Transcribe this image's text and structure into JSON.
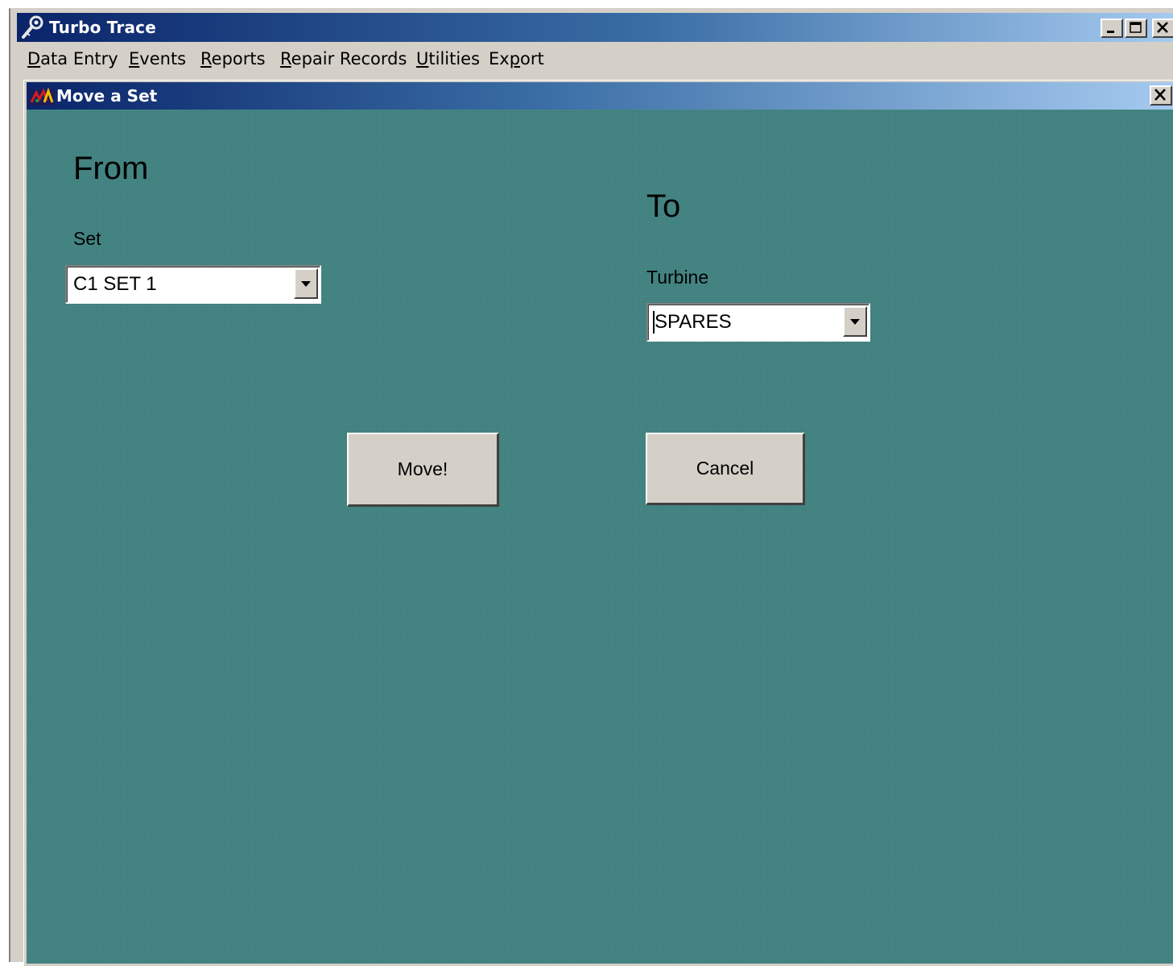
{
  "app": {
    "title": "Turbo Trace",
    "icon": "tool-key-icon",
    "controls": {
      "minimize": "minimize-icon",
      "maximize": "maximize-icon",
      "close": "close-icon"
    }
  },
  "menubar": {
    "items": [
      {
        "label": "Data Entry",
        "mnemonic": "D"
      },
      {
        "label": "Events",
        "mnemonic": "E"
      },
      {
        "label": "Reports",
        "mnemonic": "R"
      },
      {
        "label": "Repair Records",
        "mnemonic": "R"
      },
      {
        "label": "Utilities",
        "mnemonic": "U"
      },
      {
        "label": "Export",
        "mnemonic": "p"
      }
    ]
  },
  "dialog": {
    "title": "Move a Set",
    "icon": "turbine-icon",
    "from": {
      "heading": "From",
      "set_label": "Set",
      "set_value": "C1 SET 1"
    },
    "to": {
      "heading": "To",
      "turbine_label": "Turbine",
      "turbine_value": "SPARES"
    },
    "move_label": "Move!",
    "cancel_label": "Cancel"
  },
  "colors": {
    "titlebar_start": "#0a246a",
    "titlebar_end": "#a6caf0",
    "form_background": "#3f817f",
    "chrome": "#d4d0c8"
  }
}
